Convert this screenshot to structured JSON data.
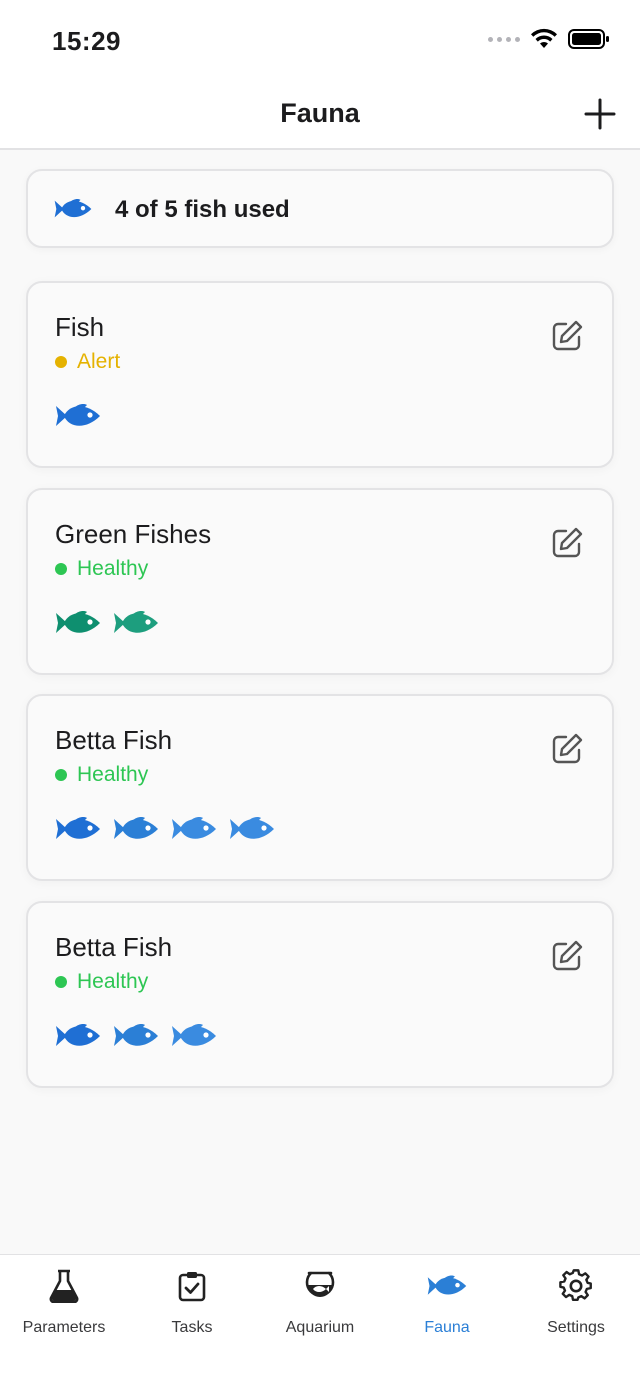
{
  "status_bar": {
    "time": "15:29"
  },
  "nav": {
    "title": "Fauna"
  },
  "summary": {
    "text": "4 of 5 fish used"
  },
  "colors": {
    "accent": "#2b7fd6",
    "alert": "#e5b200",
    "healthy": "#2dc653",
    "fish_blue_1": "#1f6fd4",
    "fish_blue_2": "#2b7fd6",
    "fish_blue_3": "#3a8be0",
    "fish_green_1": "#0e8f6f",
    "fish_green_2": "#1d9e7e"
  },
  "groups": [
    {
      "name": "Fish",
      "status": "Alert",
      "status_color": "#e5b200",
      "fish_count": 1,
      "fish_color": "blue"
    },
    {
      "name": "Green Fishes",
      "status": "Healthy",
      "status_color": "#2dc653",
      "fish_count": 2,
      "fish_color": "green"
    },
    {
      "name": "Betta Fish",
      "status": "Healthy",
      "status_color": "#2dc653",
      "fish_count": 4,
      "fish_color": "blue"
    },
    {
      "name": "Betta Fish",
      "status": "Healthy",
      "status_color": "#2dc653",
      "fish_count": 3,
      "fish_color": "blue"
    }
  ],
  "tabs": [
    {
      "label": "Parameters",
      "icon": "flask-icon"
    },
    {
      "label": "Tasks",
      "icon": "clipboard-check-icon"
    },
    {
      "label": "Aquarium",
      "icon": "fishbowl-icon"
    },
    {
      "label": "Fauna",
      "icon": "fish-icon",
      "active": true
    },
    {
      "label": "Settings",
      "icon": "gear-icon"
    }
  ]
}
